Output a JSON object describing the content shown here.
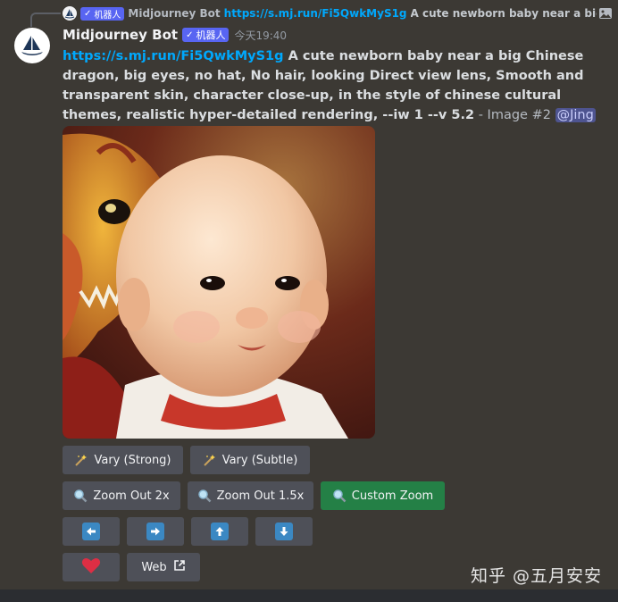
{
  "reply": {
    "username": "Midjourney Bot",
    "badge": "机器人",
    "link": "https://s.mj.run/Fi5QwkMyS1g",
    "text": "A cute newborn baby near a big C"
  },
  "message": {
    "username": "Midjourney Bot",
    "badge": "机器人",
    "timestamp": "今天19:40",
    "link": "https://s.mj.run/Fi5QwkMyS1g",
    "prompt": " A cute newborn baby near a big Chinese dragon, big eyes, no hat, No hair, looking Direct view lens, Smooth and transparent skin, character close-up, in the style of chinese cultural themes, realistic hyper-detailed rendering, --iw 1 --v 5.2",
    "suffix": " - Image #2 ",
    "mention": "@Jing"
  },
  "buttons": {
    "vary_strong": "Vary (Strong)",
    "vary_subtle": "Vary (Subtle)",
    "zoom_out_2x": "Zoom Out 2x",
    "zoom_out_15x": "Zoom Out 1.5x",
    "custom_zoom": "Custom Zoom",
    "web": "Web"
  },
  "icons": {
    "vary": "magic-wand-icon",
    "zoom": "magnifier-icon",
    "pan_left": "arrow-left-icon",
    "pan_right": "arrow-right-icon",
    "pan_up": "arrow-up-icon",
    "pan_down": "arrow-down-icon",
    "favorite": "heart-icon",
    "external": "external-link-icon"
  },
  "colors": {
    "link": "#00a8fc",
    "badge": "#5865f2",
    "button": "#4e5058",
    "button_primary": "#248046",
    "arrow": "#3b88c3",
    "heart": "#dd2e44"
  },
  "watermark": "知乎 @五月安安"
}
